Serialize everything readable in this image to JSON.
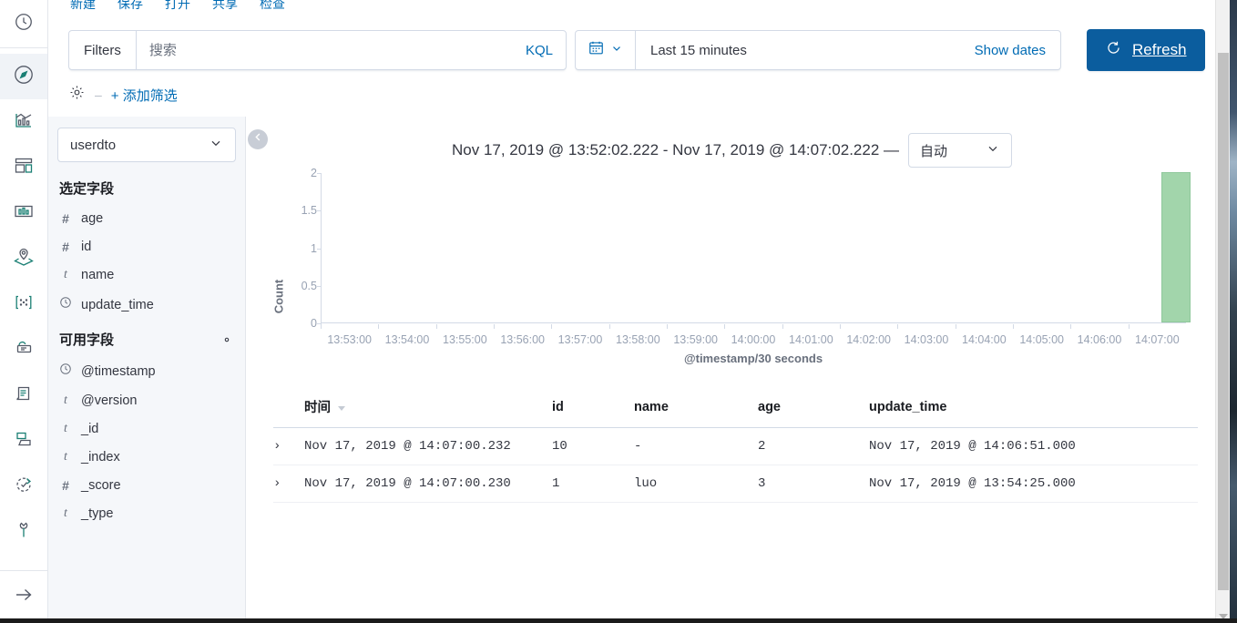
{
  "global_nav": {
    "top_icon": "clock-icon",
    "items": [
      {
        "name": "discover",
        "icon": "compass-icon",
        "selected": true
      },
      {
        "name": "visualize",
        "icon": "visualize-icon",
        "selected": false
      },
      {
        "name": "dashboard",
        "icon": "dashboard-icon",
        "selected": false
      },
      {
        "name": "canvas",
        "icon": "canvas-icon",
        "selected": false
      },
      {
        "name": "maps",
        "icon": "maps-icon",
        "selected": false
      },
      {
        "name": "machine-learning",
        "icon": "ml-icon",
        "selected": false
      },
      {
        "name": "infrastructure",
        "icon": "infrastructure-icon",
        "selected": false
      },
      {
        "name": "logs",
        "icon": "logs-icon",
        "selected": false
      },
      {
        "name": "apm",
        "icon": "apm-icon",
        "selected": false
      },
      {
        "name": "uptime",
        "icon": "uptime-icon",
        "selected": false
      },
      {
        "name": "dev-tools",
        "icon": "wrench-icon",
        "selected": false
      }
    ],
    "expand_icon": "arrow-right-icon"
  },
  "topnav": {
    "items": [
      "新建",
      "保存",
      "打开",
      "共享",
      "检查"
    ]
  },
  "query_bar": {
    "filters_label": "Filters",
    "search_placeholder": "搜索",
    "search_value": "",
    "kql_label": "KQL",
    "calendar_icon": "calendar-icon",
    "date_text": "Last 15 minutes",
    "show_dates_label": "Show dates",
    "refresh_icon": "refresh-icon",
    "refresh_label": "Refresh"
  },
  "filter_bar": {
    "gear_icon": "gear-icon",
    "add_filter_label": "+ 添加筛选"
  },
  "sidebar": {
    "index_pattern": "userdto",
    "selected_fields_title": "选定字段",
    "selected_fields": [
      {
        "type": "#",
        "label": "age"
      },
      {
        "type": "#",
        "label": "id"
      },
      {
        "type": "t",
        "label": "name"
      },
      {
        "type": "clock",
        "label": "update_time"
      }
    ],
    "available_fields_title": "可用字段",
    "available_fields_gear": "gear-icon",
    "available_fields": [
      {
        "type": "clock",
        "label": "@timestamp"
      },
      {
        "type": "t",
        "label": "@version"
      },
      {
        "type": "t",
        "label": "_id"
      },
      {
        "type": "t",
        "label": "_index"
      },
      {
        "type": "#",
        "label": "_score"
      },
      {
        "type": "t",
        "label": "_type"
      }
    ]
  },
  "main": {
    "collapse_icon": "chevron-left-icon",
    "time_range_label": "Nov 17, 2019 @ 13:52:02.222 - Nov 17, 2019 @ 14:07:02.222 —",
    "interval_value": "自动"
  },
  "chart_data": {
    "type": "bar",
    "title": "",
    "xlabel": "@timestamp/30 seconds",
    "ylabel": "Count",
    "ylim": [
      0,
      2
    ],
    "yticks": [
      0,
      0.5,
      1,
      1.5,
      2
    ],
    "categories": [
      "13:53:00",
      "13:54:00",
      "13:55:00",
      "13:56:00",
      "13:57:00",
      "13:58:00",
      "13:59:00",
      "14:00:00",
      "14:01:00",
      "14:02:00",
      "14:03:00",
      "14:04:00",
      "14:05:00",
      "14:06:00",
      "14:07:00"
    ],
    "values": [
      0,
      0,
      0,
      0,
      0,
      0,
      0,
      0,
      0,
      0,
      0,
      0,
      0,
      0,
      2
    ],
    "bar_color": "#a2d5ab",
    "grid": false,
    "legend": "none"
  },
  "table": {
    "columns": [
      "时间",
      "id",
      "name",
      "age",
      "update_time"
    ],
    "sorted_column": "时间",
    "rows": [
      {
        "expand": "›",
        "time": "Nov 17, 2019 @ 14:07:00.232",
        "id": "10",
        "name": "-",
        "age": "2",
        "update_time": "Nov 17, 2019 @ 14:06:51.000"
      },
      {
        "expand": "›",
        "time": "Nov 17, 2019 @ 14:07:00.230",
        "id": "1",
        "name": "luo",
        "age": "3",
        "update_time": "Nov 17, 2019 @ 13:54:25.000"
      }
    ]
  },
  "colors": {
    "accent_blue": "#006bb4",
    "refresh_button": "#0b5d9e",
    "bar_green": "#a2d5ab",
    "sidebar_bg": "#f5f7fa"
  }
}
